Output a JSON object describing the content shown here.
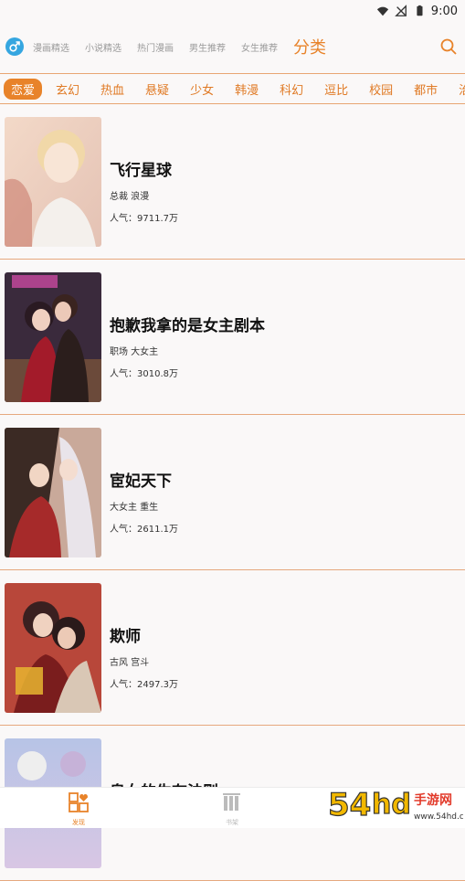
{
  "status_bar": {
    "time": "9:00"
  },
  "top_nav": {
    "tabs": [
      {
        "label": "漫画精选"
      },
      {
        "label": "小说精选"
      },
      {
        "label": "热门漫画"
      },
      {
        "label": "男生推荐"
      },
      {
        "label": "女生推荐"
      }
    ],
    "active_tab": "分类"
  },
  "categories": [
    "恋爱",
    "玄幻",
    "热血",
    "悬疑",
    "少女",
    "韩漫",
    "科幻",
    "逗比",
    "校园",
    "都市",
    "治"
  ],
  "active_category_index": 0,
  "comics": [
    {
      "title": "飞行星球",
      "tags": "总裁 浪漫",
      "popularity": "人气：9711.7万"
    },
    {
      "title": "抱歉我拿的是女主剧本",
      "tags": "职场 大女主",
      "popularity": "人气：3010.8万"
    },
    {
      "title": "宦妃天下",
      "tags": "大女主 重生",
      "popularity": "人气：2611.1万"
    },
    {
      "title": "欺师",
      "tags": "古风 宫斗",
      "popularity": "人气：2497.3万"
    },
    {
      "title": "皇女的生存法则",
      "tags": "",
      "popularity": ""
    }
  ],
  "bottom_tabs": [
    {
      "label": "发现",
      "icon": "discover-icon"
    },
    {
      "label": "书架",
      "icon": "bookshelf-icon"
    }
  ],
  "watermark": {
    "text": "54HD手游网",
    "url": "www.54hd.cn"
  },
  "colors": {
    "accent": "#e8832a",
    "gender": "#35a6e0",
    "divider": "#e6a87e"
  }
}
